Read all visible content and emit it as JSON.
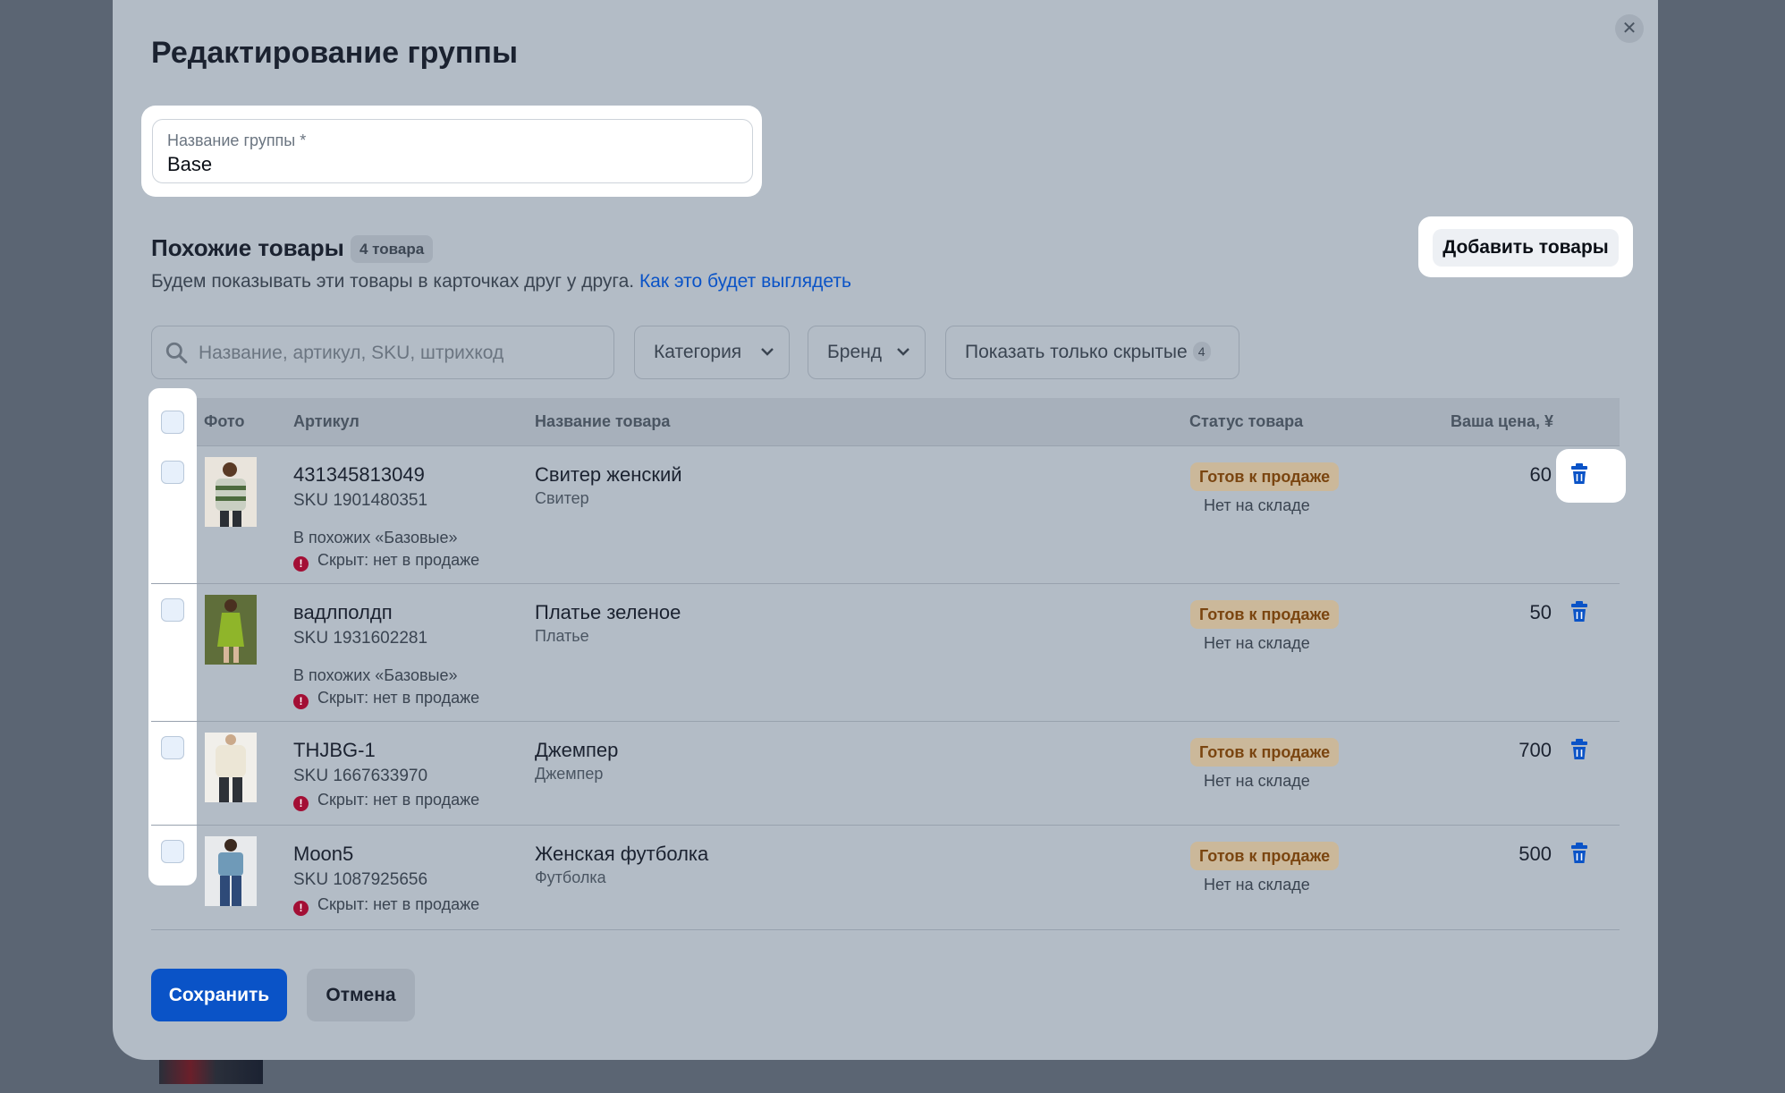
{
  "modal": {
    "title": "Редактирование группы",
    "close_icon": "close-icon"
  },
  "group_name": {
    "label": "Название группы *",
    "value": "Base"
  },
  "similar": {
    "title": "Похожие товары",
    "count": "4 товара",
    "description": "Будем показывать эти товары в карточках друг у друга.",
    "link": "Как это будет выглядеть",
    "add_button": "Добавить товары"
  },
  "filters": {
    "search_placeholder": "Название, артикул, SKU, штрихкод",
    "category": "Категория",
    "brand": "Бренд",
    "show_hidden": "Показать только скрытые",
    "hidden_count": "4"
  },
  "table": {
    "headers": {
      "photo": "Фото",
      "article": "Артикул",
      "name": "Название товара",
      "status": "Статус товара",
      "price": "Ваша цена, ¥"
    },
    "rows": [
      {
        "article": "431345813049",
        "sku": "SKU 1901480351",
        "group_note": "В похожих «Базовые»",
        "hidden_note": "Скрыт: нет в продаже",
        "name": "Свитер женский",
        "category": "Свитер",
        "status": "Готов к продаже",
        "stock": "Нет на складе",
        "price": "60"
      },
      {
        "article": "вадлполдп",
        "sku": "SKU 1931602281",
        "group_note": "В похожих «Базовые»",
        "hidden_note": "Скрыт: нет в продаже",
        "name": "Платье зеленое",
        "category": "Платье",
        "status": "Готов к продаже",
        "stock": "Нет на складе",
        "price": "50"
      },
      {
        "article": "THJBG-1",
        "sku": "SKU 1667633970",
        "hidden_note": "Скрыт: нет в продаже",
        "name": "Джемпер",
        "category": "Джемпер",
        "status": "Готов к продаже",
        "stock": "Нет на складе",
        "price": "700"
      },
      {
        "article": "Moon5",
        "sku": "SKU 1087925656",
        "hidden_note": "Скрыт: нет в продаже",
        "name": "Женская футболка",
        "category": "Футболка",
        "status": "Готов к продаже",
        "stock": "Нет на складе",
        "price": "500"
      }
    ]
  },
  "footer": {
    "save": "Сохранить",
    "cancel": "Отмена"
  },
  "colors": {
    "accent": "#0a53c7",
    "status_bg": "#cbb89a",
    "status_text": "#7a4510",
    "warning": "#a30f35"
  }
}
